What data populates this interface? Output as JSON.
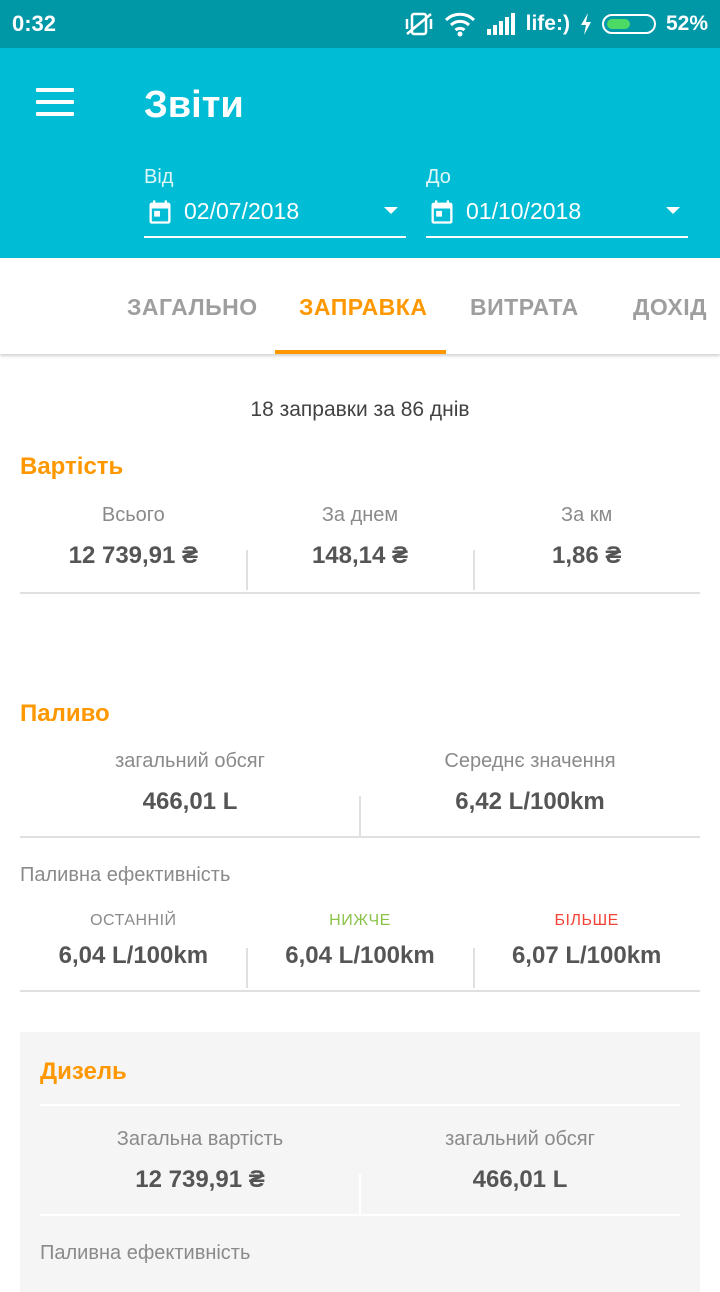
{
  "status_bar": {
    "time": "0:32",
    "carrier": "life:)",
    "battery_percent": "52%",
    "battery_level": 0.52,
    "icons": [
      "mute-vibrate-icon",
      "wifi-icon",
      "signal-icon",
      "charging-icon",
      "battery-icon"
    ]
  },
  "app_bar": {
    "title": "Звіти",
    "from_label": "Від",
    "from_value": "02/07/2018",
    "to_label": "До",
    "to_value": "01/10/2018"
  },
  "tabs": [
    {
      "label": "ЗАГАЛЬНО",
      "active": false
    },
    {
      "label": "ЗАПРАВКА",
      "active": true
    },
    {
      "label": "ВИТРАТА",
      "active": false
    },
    {
      "label": "ДОХІД",
      "active": false
    }
  ],
  "summary": "18 заправки за 86 днів",
  "cost": {
    "title": "Вартість",
    "cells": [
      {
        "label": "Всього",
        "value": "12 739,91 ₴"
      },
      {
        "label": "За днем",
        "value": "148,14 ₴"
      },
      {
        "label": "За км",
        "value": "1,86 ₴"
      }
    ]
  },
  "fuel": {
    "title": "Паливо",
    "cells": [
      {
        "label": "загальний обсяг",
        "value": "466,01 L"
      },
      {
        "label": "Середнє значення",
        "value": "6,42 L/100km"
      }
    ],
    "efficiency_label": "Паливна ефективність",
    "efficiency": [
      {
        "label": "ОСТАННІЙ",
        "value": "6,04 L/100km"
      },
      {
        "label": "НИЖЧЕ",
        "value": "6,04 L/100km"
      },
      {
        "label": "БІЛЬШЕ",
        "value": "6,07 L/100km"
      }
    ]
  },
  "diesel": {
    "title": "Дизель",
    "cells": [
      {
        "label": "Загальна вартість",
        "value": "12 739,91 ₴"
      },
      {
        "label": "загальний обсяг",
        "value": "466,01 L"
      }
    ],
    "efficiency_label": "Паливна ефективність"
  },
  "colors": {
    "status_bar": "#0097a7",
    "app_bar": "#00bcd4",
    "accent": "#ff9800",
    "lower": "#8bc34a",
    "higher": "#f44336"
  }
}
